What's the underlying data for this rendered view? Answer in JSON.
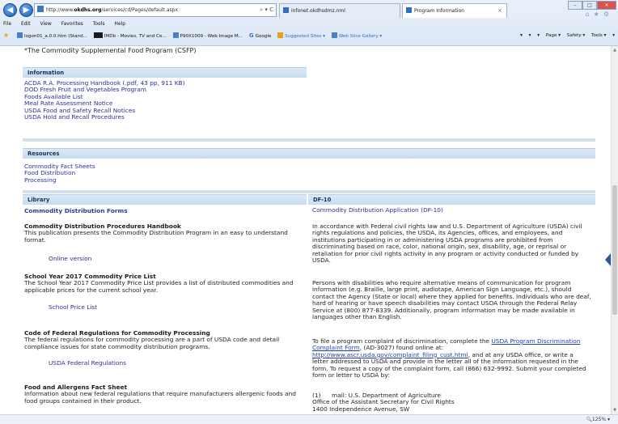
{
  "browser": {
    "url_prefix": "http://www.",
    "url_domain": "okdhs.org",
    "url_path": "/services/cd/Pages/default.aspx",
    "addr_tools": "⌕ ▾ C",
    "tabs": [
      {
        "label": "infonet.okdhsdmz.nml"
      },
      {
        "label": "Program Information"
      }
    ],
    "tab_close": "×",
    "menu": [
      "File",
      "Edit",
      "View",
      "Favorites",
      "Tools",
      "Help"
    ],
    "favorites": [
      "logon01_a.0.0.htm (Stand...",
      "IMDb - Movies, TV and Ce...",
      "P90X1009 - Web Image M...",
      "Google",
      "Suggested Sites ▾",
      "Web Slice Gallery ▾"
    ],
    "command_bar": [
      "▾",
      "▾",
      "▾",
      "Page ▾",
      "Safety ▾",
      "Tools ▾",
      "▾"
    ],
    "zoom": "🔍125%  ▾"
  },
  "page": {
    "csfp_line": "*The Commodity Supplemental Food Program (CSFP)",
    "information": {
      "header": "Information",
      "links": [
        "ACDA R.A. Processing Handbook (.pdf, 43 pp, 911 KB)",
        "DOD Fresh Fruit and Vegetables Program",
        "Foods Available List",
        "Meal Rate Assessment Notice",
        "USDA Food and Safety Recall Notices",
        "USDA Hold and Recall Procedures"
      ]
    },
    "resources": {
      "header": "Resources",
      "links": [
        "Commodity Fact Sheets",
        "Food Distribution",
        "Processing"
      ]
    },
    "library": {
      "header": "Library",
      "forms_link": "Commodity Distribution Forms",
      "items": [
        {
          "title": "Commodity Distribution Procedures Handbook",
          "body": "This publication presents the Commodity Distribution Program in an easy to understand format.",
          "link": "Online version"
        },
        {
          "title": "School Year 2017 Commodity Price List",
          "body": "The School Year 2017 Commodity Price List provides a list of distributed commodities and applicable prices for the current school year.",
          "link": "School Price List"
        },
        {
          "title": "Code of Federal Regulations for Commodity Processing",
          "body": "The federal regulations for commodity processing are a part of USDA code and detail compliance issues for state commodity distribution programs.",
          "link": "USDA Federal Regulations"
        },
        {
          "title": "Food and Allergens Fact Sheet",
          "body": "Information about new federal regulations that require manufacturers allergenic foods and food groups contained in their product.",
          "link": ""
        }
      ]
    },
    "df10": {
      "header": "DF-10",
      "app_link": "Commodity Distribution Application (DF-10)",
      "para1": "In accordance with Federal civil rights law and U.S. Department of Agriculture (USDA) civil rights regulations and policies, the USDA, its Agencies, offices, and employees, and institutions participating in or administering USDA programs are prohibited from discriminating based on race, color, national origin, sex, disability, age, or reprisal or retaliation for prior civil rights activity in any program or activity conducted or funded by USDA.",
      "para2": "Persons with disabilities who require alternative means of communication for program information (e.g. Braille, large print, audiotape, American Sign Language, etc.), should contact the Agency (State or local) where they applied for benefits. Individuals who are deaf, hard of hearing or have speech disabilities may contact USDA through the Federal Relay Service at (800) 877-8339. Additionally, program information may be made available in languages other than English.",
      "para3_a": "To file a program complaint of discrimination, complete the ",
      "para3_link1": "USDA Program Discrimination Complaint Form",
      "para3_b": ", (AD-3027) found online at: ",
      "para3_link2": "http://www.ascr.usda.gov/complaint_filing_cust.html",
      "para3_c": ", and at any USDA office, or write a letter addressed to USDA and provide in the letter all of the information requested in the form. To request a copy of the complaint form, call (866) 632-9992. Submit your completed form or letter to USDA by:",
      "mail_num": "(1)",
      "mail_lines": [
        "mail: U.S. Department of Agriculture",
        "Office of the Assistant Secretary for Civil Rights",
        "1400 Independence Avenue, SW"
      ]
    }
  }
}
